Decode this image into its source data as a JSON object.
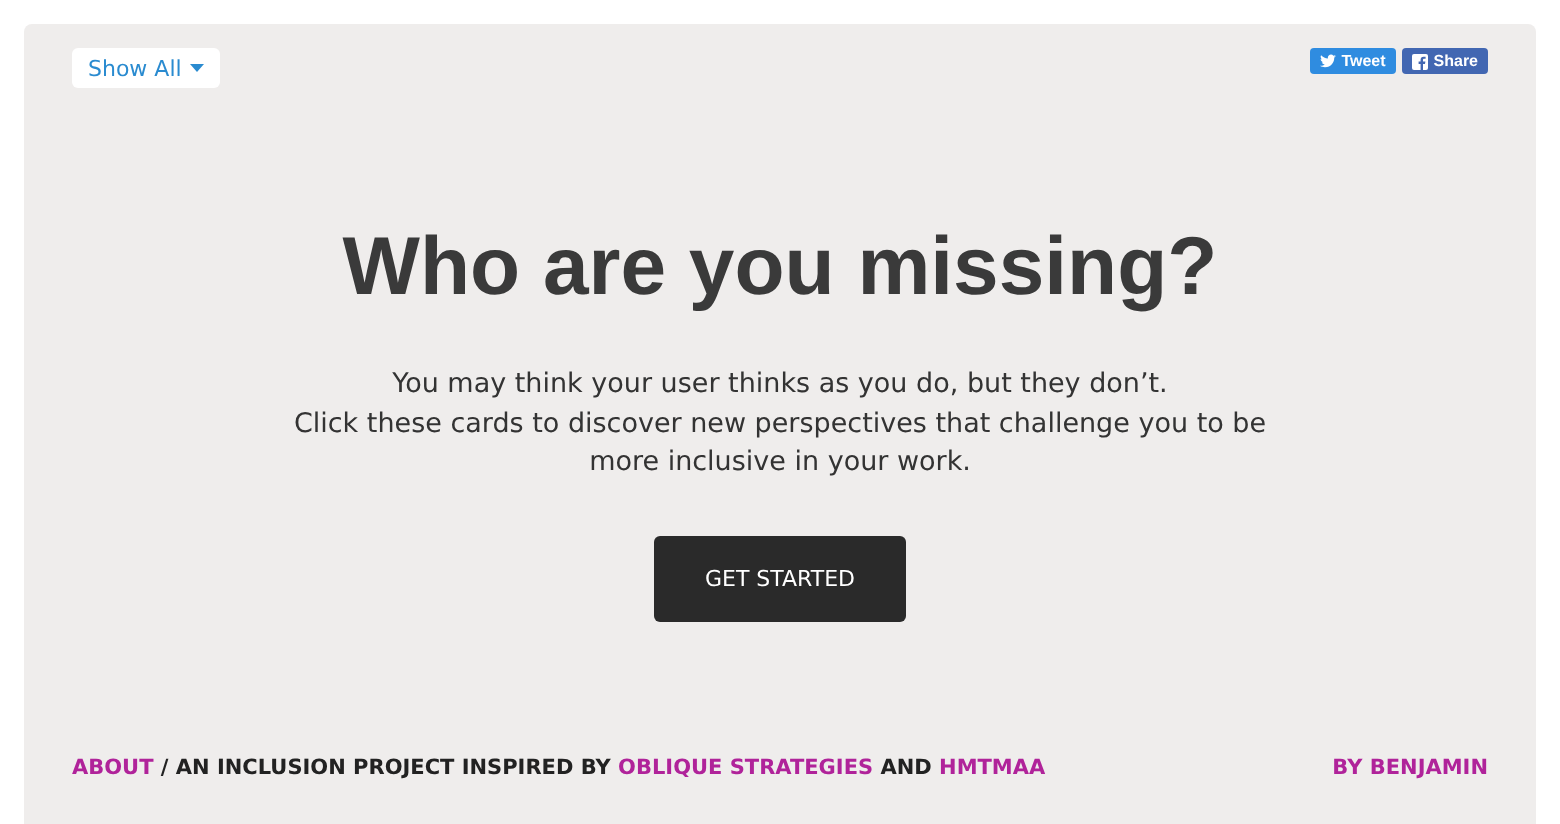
{
  "filter": {
    "value": "Show All"
  },
  "share_buttons": [
    {
      "kind": "twitter",
      "label": "Tweet"
    },
    {
      "kind": "facebook",
      "label": "Share"
    }
  ],
  "heading": "Who are you missing?",
  "intro": [
    "You may think your user thinks as you do, but they don’t.",
    "Click these cards to discover new perspectives that challenge you to be",
    "more inclusive in your work."
  ],
  "cta": "GET STARTED",
  "footer": {
    "parts": [
      {
        "kind": "link",
        "text": "ABOUT"
      },
      {
        "kind": "text",
        "text": " / AN INCLUSION PROJECT INSPIRED BY "
      },
      {
        "kind": "link",
        "text": "OBLIQUE STRATEGIES"
      },
      {
        "kind": "text",
        "text": " AND "
      },
      {
        "kind": "link",
        "text": "HMTMAA"
      }
    ],
    "byline": "BY BENJAMIN"
  }
}
